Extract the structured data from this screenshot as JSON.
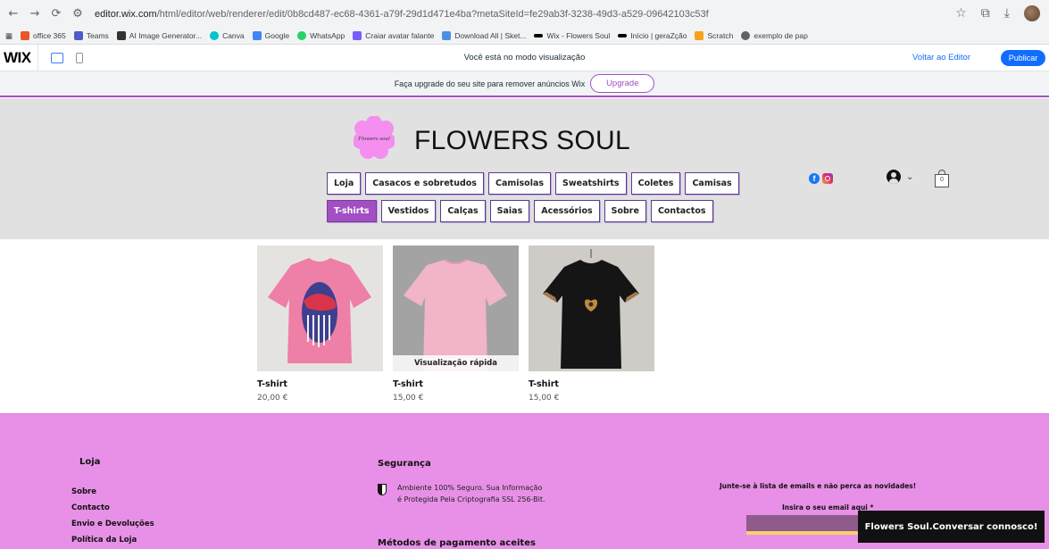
{
  "browser": {
    "url_host": "editor.wix.com",
    "url_path": "/html/editor/web/renderer/edit/0b8cd487-ec68-4361-a79f-29d1d471e4ba?metaSiteId=fe29ab3f-3238-49d3-a529-09642103c53f",
    "bookmarks": [
      {
        "label": "office 365",
        "color": "#e8562a"
      },
      {
        "label": "Teams",
        "color": "#5059c9"
      },
      {
        "label": "AI Image Generator...",
        "color": "#333333"
      },
      {
        "label": "Canva",
        "color": "#00c4cc"
      },
      {
        "label": "Google",
        "color": "#4285f4"
      },
      {
        "label": "WhatsApp",
        "color": "#25d366"
      },
      {
        "label": "Craiar avatar falante",
        "color": "#7b5cff"
      },
      {
        "label": "Download All | Sket...",
        "color": "#4a90e2"
      },
      {
        "label": "Wix - Flowers Soul",
        "color": "#000000"
      },
      {
        "label": "Início | geraZção",
        "color": "#000000"
      },
      {
        "label": "Scratch",
        "color": "#f7a21b"
      },
      {
        "label": "exemplo de pap",
        "color": "#5f6368"
      }
    ]
  },
  "wix_bar": {
    "logo": "WIX",
    "preview_message": "Você está no modo visualização",
    "back_to_editor": "Voltar ao Editor",
    "publish": "Publicar"
  },
  "upgrade_banner": {
    "text": "Faça upgrade do seu site para remover anúncios Wix",
    "button": "Upgrade"
  },
  "site": {
    "logo_text": "Flowers soul",
    "brand": "FLOWERS SOUL",
    "menu_row1": [
      "Loja",
      "Casacos e sobretudos",
      "Camisolas",
      "Sweatshirts",
      "Coletes",
      "Camisas"
    ],
    "menu_row2": [
      "T-shirts",
      "Vestidos",
      "Calças",
      "Saias",
      "Acessórios",
      "Sobre",
      "Contactos"
    ],
    "active_menu": "T-shirts",
    "cart_count": "0",
    "accent_color": "#a34fc4"
  },
  "products": [
    {
      "name": "T-shirt",
      "price": "20,00 €",
      "quick_view": ""
    },
    {
      "name": "T-shirt",
      "price": "15,00 €",
      "quick_view": "Visualização rápida"
    },
    {
      "name": "T-shirt",
      "price": "15,00 €",
      "quick_view": ""
    }
  ],
  "footer": {
    "shop_title": "Loja",
    "links": [
      "Sobre",
      "Contacto",
      "Envio e Devoluções",
      "Política da Loja"
    ],
    "security_title": "Segurança",
    "security_line1": "Ambiente 100% Seguro. Sua Informação",
    "security_line2": "é Protegida Pela Criptografia SSL 256-Bit.",
    "payment_title": "Métodos de pagamento aceites",
    "newsletter": "Junte-se à lista de emails e não perca as novidades!",
    "email_label": "Insira o seu email aqui *",
    "chat": "Flowers Soul.Conversar connosco!"
  }
}
